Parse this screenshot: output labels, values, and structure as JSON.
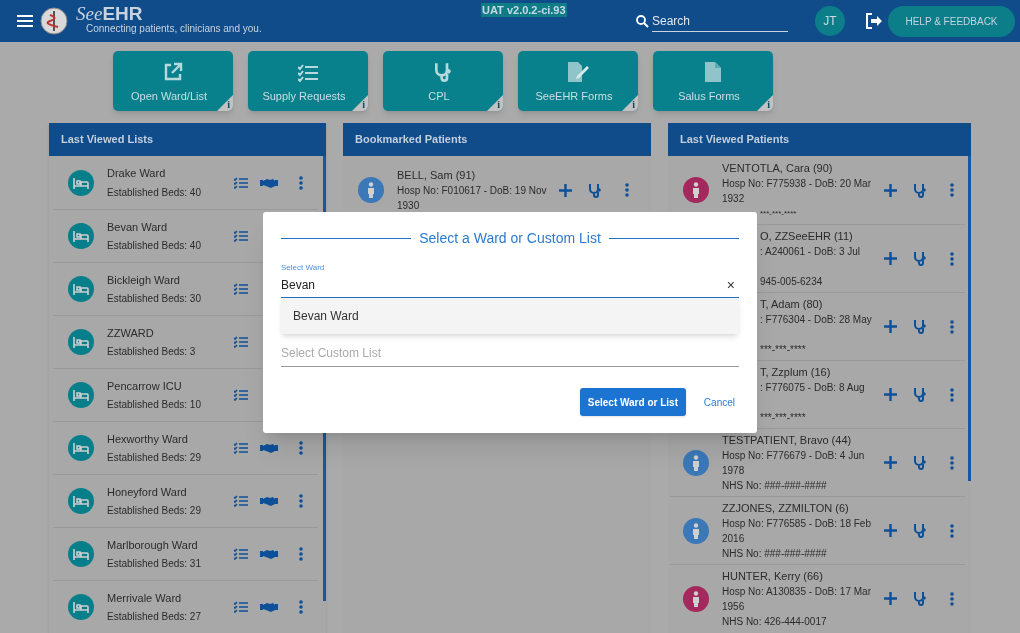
{
  "header": {
    "brand": {
      "light": "See",
      "bold": "EHR"
    },
    "tagline": "Connecting patients, clinicians and you.",
    "version": "UAT v2.0.2-ci.93",
    "search": {
      "placeholder": "Search"
    },
    "user_initials": "JT",
    "help_button": "HELP & FEEDBACK"
  },
  "tiles": [
    {
      "kind": "open",
      "label": "Open Ward/List",
      "info": "i"
    },
    {
      "kind": "checklist",
      "label": "Supply Requests",
      "info": "i"
    },
    {
      "kind": "stethoscope",
      "label": "CPL",
      "info": "i"
    },
    {
      "kind": "form",
      "label": "SeeEHR Forms",
      "info": "i"
    },
    {
      "kind": "document",
      "label": "Salus Forms",
      "info": "i"
    }
  ],
  "last_viewed_lists": {
    "title": "Last Viewed Lists",
    "items": [
      {
        "name": "Drake Ward",
        "beds": "Established Beds: 40",
        "actions_covered": false
      },
      {
        "name": "Bevan Ward",
        "beds": "Established Beds: 40",
        "actions_covered": true
      },
      {
        "name": "Bickleigh Ward",
        "beds": "Established Beds: 30",
        "actions_covered": true
      },
      {
        "name": "ZZWARD",
        "beds": "Established Beds: 3",
        "actions_covered": true
      },
      {
        "name": "Pencarrow ICU",
        "beds": "Established Beds: 10",
        "actions_covered": true
      },
      {
        "name": "Hexworthy Ward",
        "beds": "Established Beds: 29",
        "actions_covered": false
      },
      {
        "name": "Honeyford Ward",
        "beds": "Established Beds: 29",
        "actions_covered": false
      },
      {
        "name": "Marlborough Ward",
        "beds": "Established Beds: 31",
        "actions_covered": false
      },
      {
        "name": "Merrivale Ward",
        "beds": "Established Beds: 27",
        "actions_covered": false
      }
    ]
  },
  "bookmarked_patients": {
    "title": "Bookmarked Patients",
    "items": [
      {
        "name": "BELL, Sam (91)",
        "details": "Hosp No: F010617 - DoB: 19 Nov 1930",
        "color": "#3a78b8"
      }
    ]
  },
  "last_viewed_patients": {
    "title": "Last Viewed Patients",
    "items": [
      {
        "name": "VENTOTLA, Cara (90)",
        "details": "Hosp No: F775938 - DoB: 20 Mar 1932",
        "nhs": "***-***-****",
        "color": "#a3285c",
        "left_covered": false,
        "nhs_covered": true
      },
      {
        "name": "O, ZZSeeEHR (11)",
        "details": ": A240061 - DoB: 3 Jul",
        "nhs": "945-005-6234",
        "left_covered": true,
        "nhs_covered": false
      },
      {
        "name": "T, Adam (80)",
        "details": ": F776304 - DoB: 28 May",
        "nhs": "***-***-****",
        "left_covered": true,
        "nhs_covered": false
      },
      {
        "name": "T, Zzplum (16)",
        "details": ": F776075 - DoB: 8 Aug",
        "nhs": "***-***-****",
        "left_covered": true,
        "nhs_covered": false
      },
      {
        "name": "TESTPATIENT, Bravo (44)",
        "details": "Hosp No: F776679 - DoB: 4 Jun 1978",
        "nhs": "NHS No: ###-###-####",
        "color": "#3a78b8",
        "left_covered": false,
        "nhs_covered": false
      },
      {
        "name": "ZZJONES, ZZMILTON (6)",
        "details": "Hosp No: F776585 - DoB: 18 Feb 2016",
        "nhs": "NHS No: ###-###-####",
        "color": "#3a78b8",
        "left_covered": false,
        "nhs_covered": false
      },
      {
        "name": "HUNTER, Kerry (66)",
        "details": "Hosp No: A130835 - DoB: 17 Mar 1956",
        "nhs": "NHS No: 426-444-0017",
        "color": "#a3285c",
        "left_covered": false,
        "nhs_covered": false
      }
    ]
  },
  "dialog": {
    "title": "Select a Ward or Custom List",
    "ward_field": {
      "label": "Select Ward",
      "value": "Bevan"
    },
    "clear": "×",
    "options": [
      {
        "label": "Bevan Ward",
        "selected": false
      }
    ],
    "custom_list_field": {
      "placeholder": "Select Custom List"
    },
    "buttons": [
      {
        "kind": "primary",
        "label": "Select Ward or List"
      },
      {
        "kind": "text",
        "label": "Cancel"
      }
    ]
  }
}
